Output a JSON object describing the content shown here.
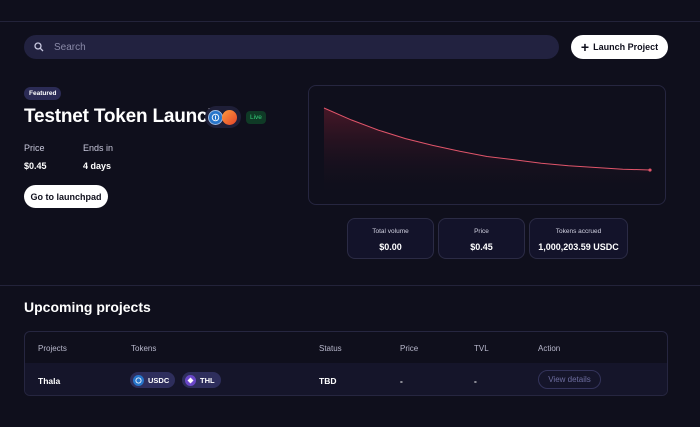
{
  "search": {
    "placeholder": "Search"
  },
  "header": {
    "launch_label": "Launch Project"
  },
  "featured": {
    "badge": "Featured",
    "title": "Testnet Token Launch",
    "status": "Live",
    "price_label": "Price",
    "price_value": "$0.45",
    "ends_label": "Ends in",
    "ends_value": "4 days",
    "cta_label": "Go to launchpad"
  },
  "chart_data": {
    "type": "area",
    "title": "",
    "xlabel": "",
    "ylabel": "",
    "values": [
      1.0,
      0.86,
      0.74,
      0.64,
      0.56,
      0.49,
      0.43,
      0.39,
      0.35,
      0.32,
      0.3,
      0.28,
      0.27
    ],
    "line_color": "#e0556a"
  },
  "metrics": [
    {
      "label": "Total volume",
      "value": "$0.00"
    },
    {
      "label": "Price",
      "value": "$0.45"
    },
    {
      "label": "Tokens accrued",
      "value": "1,000,203.59 USDC"
    }
  ],
  "upcoming": {
    "title": "Upcoming projects",
    "columns": [
      "Projects",
      "Tokens",
      "Status",
      "Price",
      "TVL",
      "Action"
    ],
    "rows": [
      {
        "project": "Thala",
        "tokens": [
          "USDC",
          "THL"
        ],
        "status": "TBD",
        "price": "-",
        "tvl": "-",
        "action": "View details"
      }
    ]
  },
  "colors": {
    "background": "#0f0f1c",
    "accent_line": "#e0556a",
    "live": "#34d07a"
  }
}
